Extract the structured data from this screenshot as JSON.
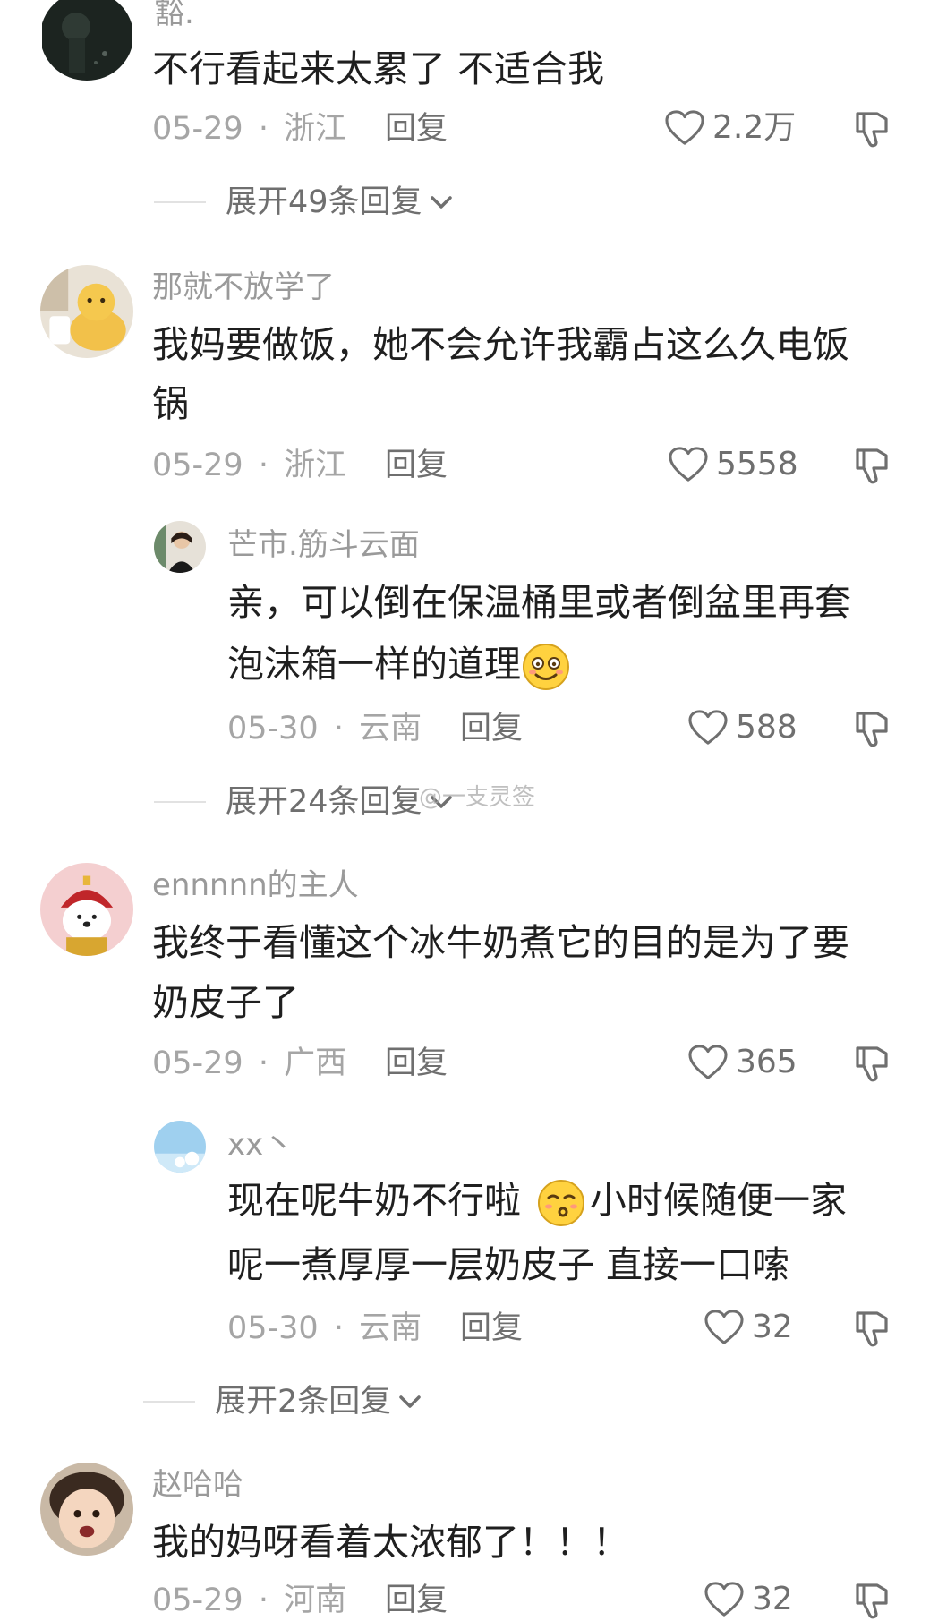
{
  "comments": [
    {
      "username": "豁.",
      "text": "不行看起来太累了 不适合我",
      "date": "05-29",
      "location": "浙江",
      "reply_label": "回复",
      "likes": "2.2万",
      "expand": "展开49条回复"
    },
    {
      "username": "那就不放学了",
      "text_line1": "我妈要做饭，她不会允许我霸占这么久电饭",
      "text_line2": "锅",
      "date": "05-29",
      "location": "浙江",
      "reply_label": "回复",
      "likes": "5558",
      "reply": {
        "username": "芒市.筋斗云面",
        "text_line1": "亲，可以倒在保温桶里或者倒盆里再套",
        "text_line2": "泡沫箱一样的道理",
        "date": "05-30",
        "location": "云南",
        "reply_label": "回复",
        "likes": "588"
      },
      "expand": "展开24条回复"
    },
    {
      "username": "ennnnn的主人",
      "text_line1": "我终于看懂这个冰牛奶煮它的目的是为了要",
      "text_line2": "奶皮子了",
      "date": "05-29",
      "location": "广西",
      "reply_label": "回复",
      "likes": "365",
      "reply": {
        "username": "xx丶",
        "text_line1_a": "现在呢牛奶不行啦",
        "text_line1_b": "小时候随便一家",
        "text_line2": "呢一煮厚厚一层奶皮子 直接一口嗦",
        "date": "05-30",
        "location": "云南",
        "reply_label": "回复",
        "likes": "32"
      },
      "expand": "展开2条回复"
    },
    {
      "username": "赵哈哈",
      "text": "我的妈呀看着太浓郁了！！！",
      "date": "05-29",
      "location": "河南",
      "reply_label": "回复",
      "likes": "32"
    }
  ],
  "separator": "·",
  "watermark": "@一支灵签",
  "icons": {
    "like": "heart-outline-icon",
    "dislike": "thumbs-down-icon",
    "expand": "chevron-down-icon",
    "emoji_1": "smiling-face-emoji",
    "emoji_2": "whistling-face-emoji"
  }
}
